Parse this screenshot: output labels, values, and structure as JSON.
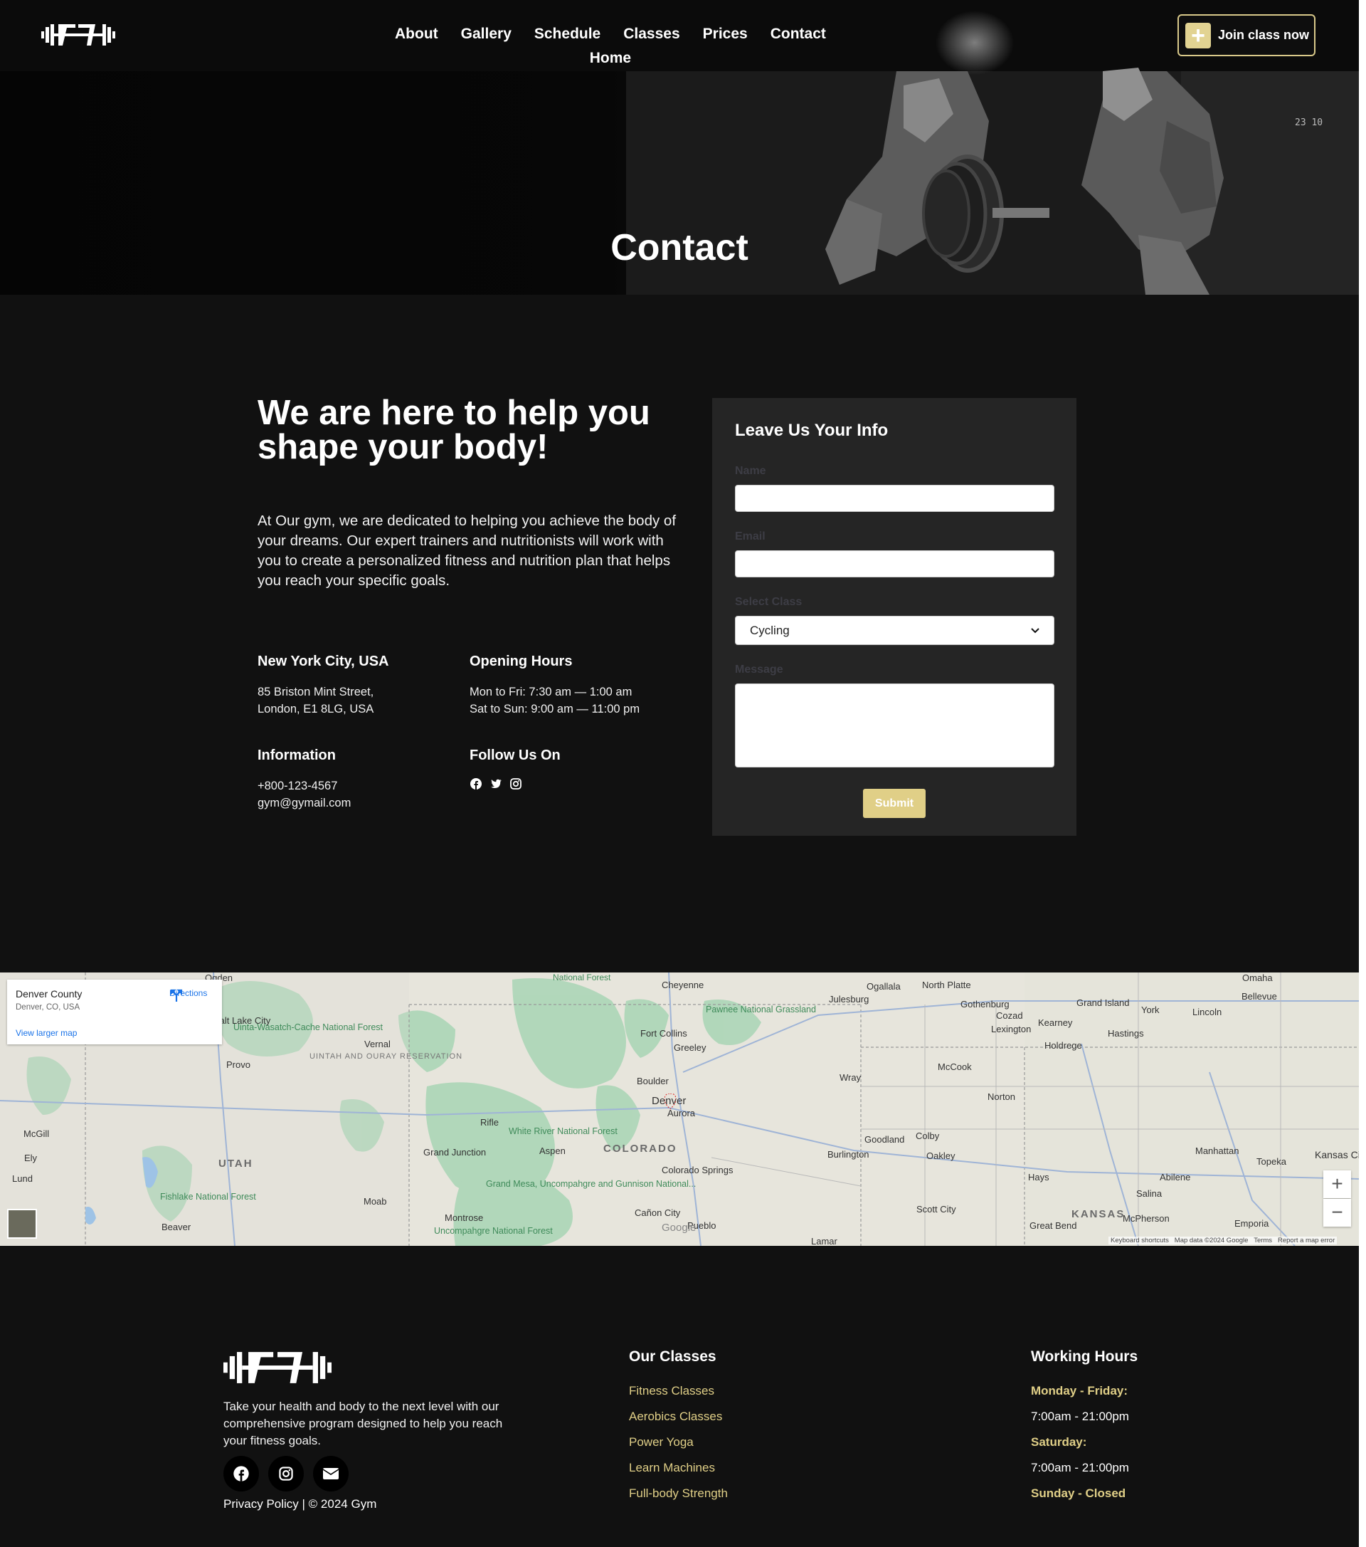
{
  "nav": {
    "items": [
      "Home",
      "About",
      "Gallery",
      "Schedule",
      "Classes",
      "Prices",
      "Contact"
    ],
    "join_label": "Join class now"
  },
  "hero": {
    "title": "Contact",
    "badge": "23 10"
  },
  "intro": {
    "title": "We are here to help you shape your body!",
    "text": "At Our gym, we are dedicated to helping you achieve the body of your dreams. Our expert trainers and nutritionists will work with you to create a personalized fitness and nutrition plan that helps you reach your specific goals."
  },
  "info": {
    "location": {
      "title": "New York City, USA",
      "line1": "85 Briston Mint Street,",
      "line2": "London, E1 8LG, USA"
    },
    "hours": {
      "title": "Opening Hours",
      "line1": "Mon to Fri: 7:30 am — 1:00 am",
      "line2": "Sat to Sun: 9:00 am — 11:00 pm"
    },
    "information": {
      "title": "Information",
      "phone": "+800-123-4567",
      "email": "gym@gymail.com"
    },
    "follow": {
      "title": "Follow Us On",
      "icons": [
        "facebook-icon",
        "twitter-icon",
        "instagram-icon"
      ]
    }
  },
  "form": {
    "title": "Leave Us Your Info",
    "name_label": "Name",
    "email_label": "Email",
    "class_label": "Select Class",
    "class_value": "Cycling",
    "message_label": "Message",
    "submit_label": "Submit"
  },
  "map": {
    "card_title": "Denver County",
    "card_subtitle": "Denver, CO, USA",
    "directions_label": "Directions",
    "larger_map_label": "View larger map",
    "footer_links": [
      "Keyboard shortcuts",
      "Map data ©2024 Google",
      "Terms",
      "Report a map error"
    ],
    "google_label": "Google",
    "state_labels": [
      "UTAH",
      "COLORADO",
      "KANSAS"
    ],
    "city_labels": [
      "Cheyenne",
      "Fort Collins",
      "Greeley",
      "Boulder",
      "Denver",
      "Aurora",
      "Colorado Springs",
      "Pueblo",
      "Cañon City",
      "Grand Junction",
      "Montrose",
      "Rifle",
      "Aspen",
      "Vernal",
      "Provo",
      "Moab",
      "McGill",
      "Ely",
      "Lund",
      "Beaver",
      "Ogden",
      "Julesburg",
      "North Platte",
      "Ogallala",
      "Gothenburg",
      "Cozad",
      "Lexington",
      "Kearney",
      "Grand Island",
      "Hastings",
      "Holdrege",
      "McCook",
      "York",
      "Lincoln",
      "Omaha",
      "Bellevue",
      "Norton",
      "Wray",
      "Burlington",
      "Goodland",
      "Colby",
      "Oakley",
      "Hays",
      "Abilene",
      "Salina",
      "Manhattan",
      "Topeka",
      "Emporia",
      "McPherson",
      "Great Bend",
      "Scott City",
      "Lamar",
      "Kansas City",
      "Salt Lake City"
    ],
    "park_labels": [
      "National Forest",
      "Pawnee National Grassland",
      "Uinta-Wasatch-Cache National Forest",
      "UINTAH AND OURAY RESERVATION",
      "White River National Forest",
      "Grand Mesa, Uncompahgre and Gunnison National...",
      "Uncompahgre National Forest",
      "Fishlake National Forest"
    ],
    "zoom_in": "+",
    "zoom_out": "−"
  },
  "footer": {
    "text": "Take your health and body to the next level with our comprehensive program designed to help you reach your fitness goals.",
    "social_icons": [
      "facebook-icon",
      "instagram-icon",
      "envelope-icon"
    ],
    "privacy": "Privacy Policy",
    "copyright": "| © 2024 Gym",
    "classes_title": "Our Classes",
    "classes": [
      "Fitness Classes",
      "Aerobics Classes",
      "Power Yoga",
      "Learn Machines",
      "Full-body Strength"
    ],
    "hours_title": "Working Hours",
    "hours": [
      {
        "text": "Monday - Friday:",
        "style": "label"
      },
      {
        "text": "7:00am - 21:00pm",
        "style": "value"
      },
      {
        "text": "Saturday:",
        "style": "label"
      },
      {
        "text": "7:00am - 21:00pm",
        "style": "value"
      },
      {
        "text": "Sunday - Closed",
        "style": "label"
      }
    ]
  },
  "colors": {
    "accent": "#e0cf87",
    "background": "#111111",
    "card": "#252525"
  }
}
